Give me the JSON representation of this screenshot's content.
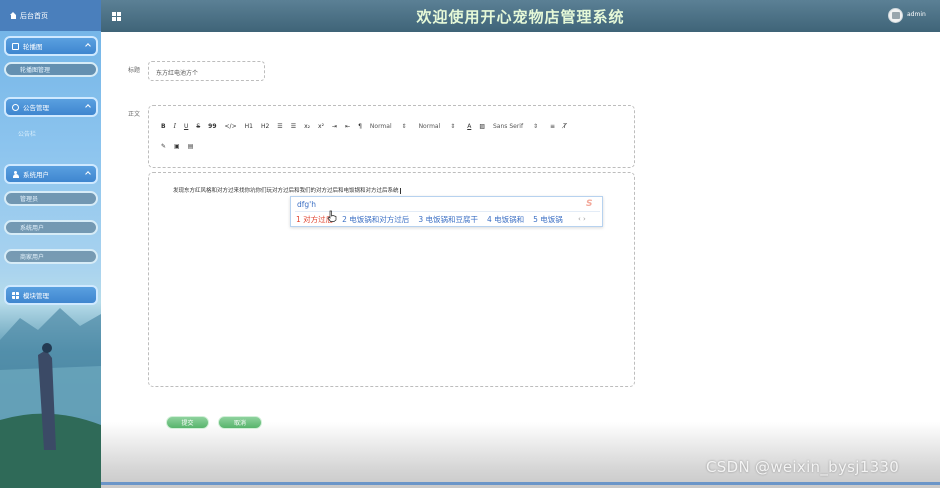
{
  "sidebar": {
    "home": "后台首页",
    "groups": [
      {
        "label": "轮播图",
        "items": [
          "轮播图管理"
        ]
      },
      {
        "label": "公告管理",
        "items": [
          "公告栏"
        ]
      },
      {
        "label": "系统用户",
        "items": [
          "管理员",
          "系统用户",
          "商家用户"
        ]
      },
      {
        "label": "模块管理",
        "items": []
      }
    ]
  },
  "header": {
    "title": "欢迎使用开心宠物店管理系统",
    "user": "admin"
  },
  "form": {
    "title_label": "标题",
    "title_value": "东方红电池方个",
    "body_label": "正文",
    "body_text": "发现东方红风格和对方过来找你坑你们玩对方过后和我们的对方过后和电饭锅和对方过后系统",
    "submit": "提交",
    "cancel": "取消"
  },
  "toolbar": {
    "row1": [
      "B",
      "I",
      "U",
      "S",
      "99",
      "</>",
      "H1",
      "H2",
      "list-ordered",
      "list-bullet",
      "X2",
      "X2sup",
      "indent",
      "outdent",
      "rtl"
    ],
    "header_select": "Normal",
    "size_select": "Normal",
    "font_select": "Sans Serif"
  },
  "ime": {
    "pinyin": "dfg'h",
    "candidates": [
      "1 对方过后",
      "2 电饭锅和对方过后",
      "3 电饭锅和豆腐干",
      "4 电饭锅和",
      "5 电饭锅"
    ],
    "nav": "‹ ›"
  },
  "watermark": "CSDN @weixin_bysj1330",
  "colors": {
    "header_bg": "#4f7488",
    "header_title": "#e6f9d8",
    "menu_blue": "#4a8fd6",
    "button_green": "#6cc07e",
    "ime_text": "#3b6fc4",
    "ime_first": "#e0432f"
  }
}
